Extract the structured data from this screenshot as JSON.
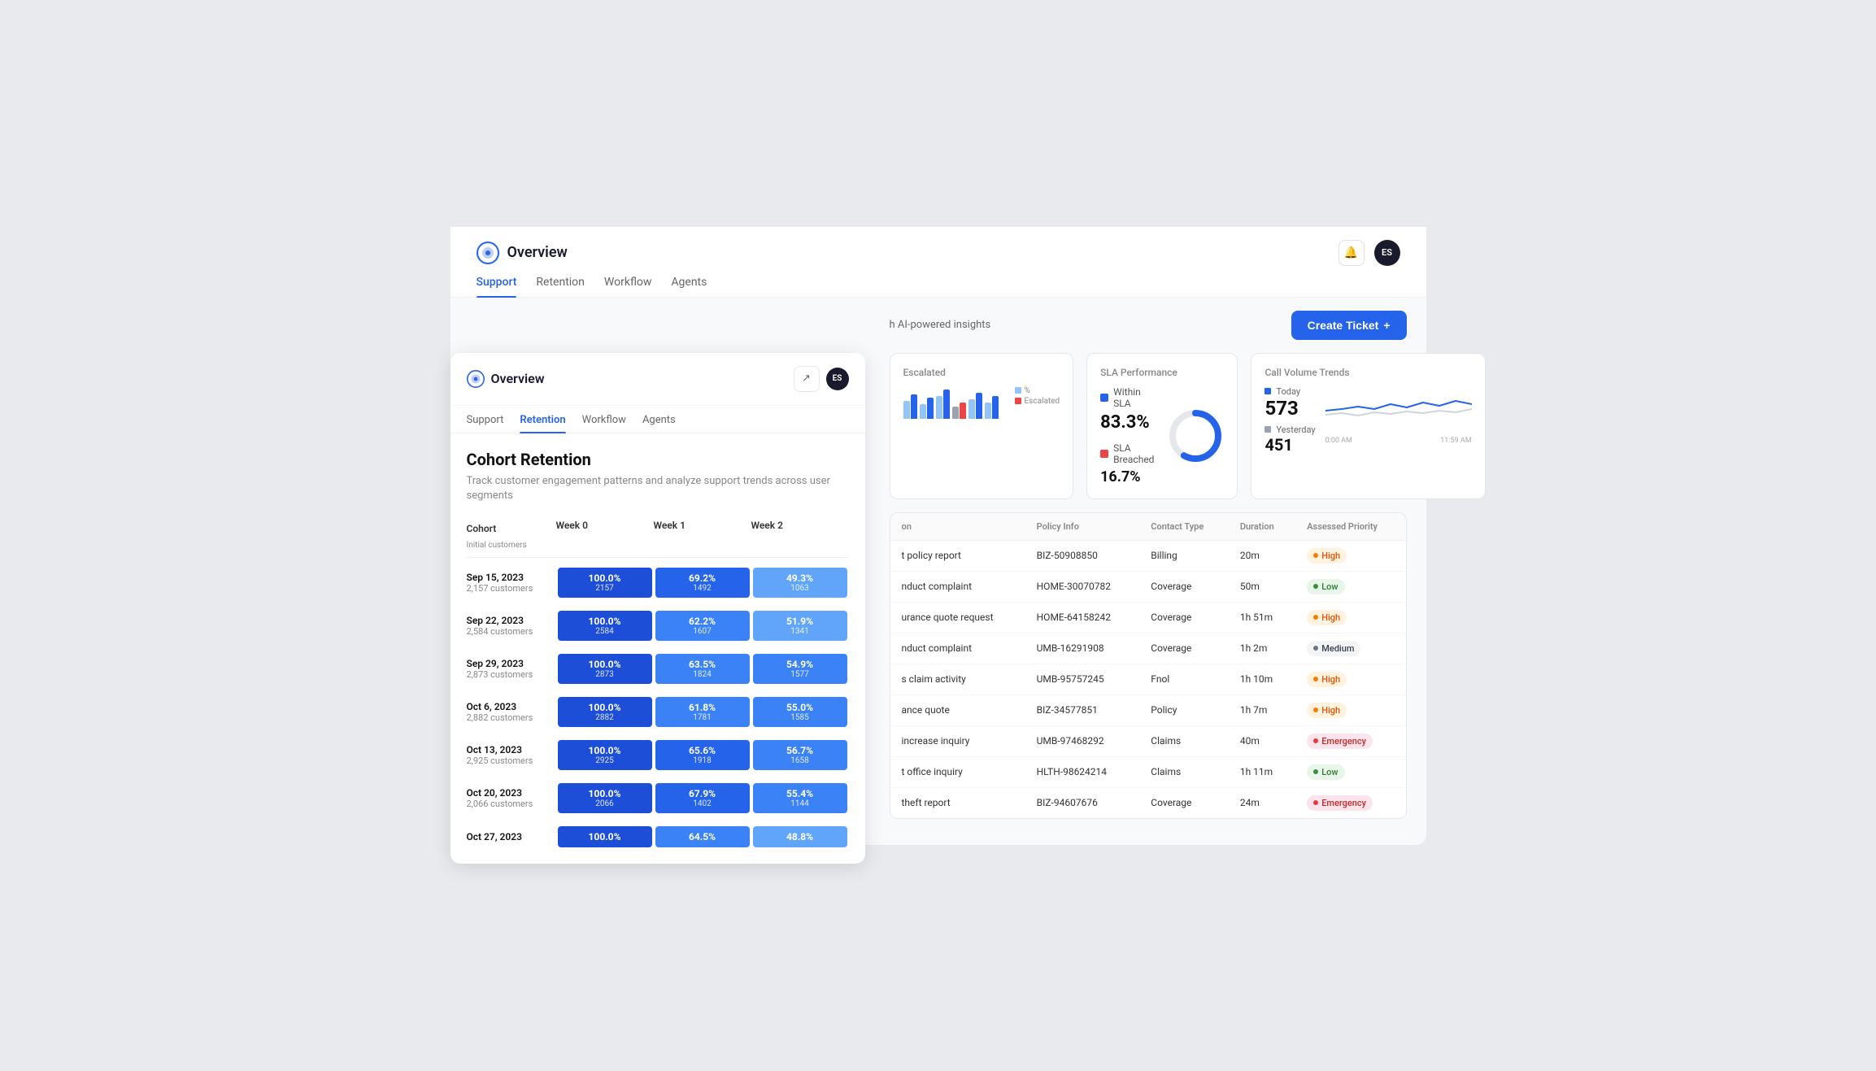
{
  "app": {
    "title": "Overview",
    "logo_alt": "app-logo"
  },
  "top_nav": {
    "items": [
      {
        "label": "Support",
        "active": false
      },
      {
        "label": "Retention",
        "active": false
      },
      {
        "label": "Workflow",
        "active": false
      },
      {
        "label": "Agents",
        "active": false
      }
    ]
  },
  "top_actions": {
    "notification_icon": "🔔",
    "avatar_initials": "ES"
  },
  "left_panel": {
    "title": "Overview",
    "avatar_initials": "ES",
    "nav_items": [
      {
        "label": "Support",
        "active": false
      },
      {
        "label": "Retention",
        "active": true
      },
      {
        "label": "Workflow",
        "active": false
      },
      {
        "label": "Agents",
        "active": false
      }
    ],
    "cohort": {
      "title": "Cohort Retention",
      "description": "Track customer engagement patterns and analyze support trends across user segments",
      "headers": {
        "cohort": "Cohort",
        "sub": "Initial customers",
        "week0": "Week 0",
        "week1": "Week 1",
        "week2": "Week 2"
      },
      "rows": [
        {
          "date": "Sep 15, 2023",
          "customers": "2,157 customers",
          "week0": {
            "pct": "100.0%",
            "val": "2157",
            "intensity": 1.0
          },
          "week1": {
            "pct": "69.2%",
            "val": "1492",
            "intensity": 0.69
          },
          "week2": {
            "pct": "49.3%",
            "val": "1063",
            "intensity": 0.49
          }
        },
        {
          "date": "Sep 22, 2023",
          "customers": "2,584 customers",
          "week0": {
            "pct": "100.0%",
            "val": "2584",
            "intensity": 1.0
          },
          "week1": {
            "pct": "62.2%",
            "val": "1607",
            "intensity": 0.62
          },
          "week2": {
            "pct": "51.9%",
            "val": "1341",
            "intensity": 0.52
          }
        },
        {
          "date": "Sep 29, 2023",
          "customers": "2,873 customers",
          "week0": {
            "pct": "100.0%",
            "val": "2873",
            "intensity": 1.0
          },
          "week1": {
            "pct": "63.5%",
            "val": "1824",
            "intensity": 0.635
          },
          "week2": {
            "pct": "54.9%",
            "val": "1577",
            "intensity": 0.55
          }
        },
        {
          "date": "Oct 6, 2023",
          "customers": "2,882 customers",
          "week0": {
            "pct": "100.0%",
            "val": "2882",
            "intensity": 1.0
          },
          "week1": {
            "pct": "61.8%",
            "val": "1781",
            "intensity": 0.618
          },
          "week2": {
            "pct": "55.0%",
            "val": "1585",
            "intensity": 0.55
          }
        },
        {
          "date": "Oct 13, 2023",
          "customers": "2,925 customers",
          "week0": {
            "pct": "100.0%",
            "val": "2925",
            "intensity": 1.0
          },
          "week1": {
            "pct": "65.6%",
            "val": "1918",
            "intensity": 0.656
          },
          "week2": {
            "pct": "56.7%",
            "val": "1658",
            "intensity": 0.567
          }
        },
        {
          "date": "Oct 20, 2023",
          "customers": "2,066 customers",
          "week0": {
            "pct": "100.0%",
            "val": "2066",
            "intensity": 1.0
          },
          "week1": {
            "pct": "67.9%",
            "val": "1402",
            "intensity": 0.679
          },
          "week2": {
            "pct": "55.4%",
            "val": "1144",
            "intensity": 0.554
          }
        },
        {
          "date": "Oct 27, 2023",
          "customers": "",
          "week0": {
            "pct": "100.0%",
            "val": "",
            "intensity": 1.0
          },
          "week1": {
            "pct": "64.5%",
            "val": "",
            "intensity": 0.645
          },
          "week2": {
            "pct": "48.8%",
            "val": "",
            "intensity": 0.488
          }
        }
      ]
    }
  },
  "dashboard": {
    "subtitle": "h AI-powered insights",
    "create_ticket_label": "Create Ticket",
    "metric_cards": {
      "card1": {
        "title": "SLA Performance",
        "within_sla_label": "Within SLA",
        "within_sla_value": "83.3%",
        "breached_label": "SLA Breached",
        "breached_value": "16.7%"
      },
      "card2": {
        "title": "Call Volume Trends",
        "today_label": "Today",
        "today_value": "573",
        "yesterday_label": "Yesterday",
        "yesterday_value": "451",
        "time_start": "0:00 AM",
        "time_end": "11:59 AM"
      }
    },
    "first_card": {
      "escalated_label": "Escalated",
      "escalated_pct": "%"
    },
    "table": {
      "columns": [
        "on",
        "Policy Info",
        "Contact Type",
        "Duration",
        "Assessed Priority"
      ],
      "rows": [
        {
          "desc": "t policy report",
          "policy": "BIZ-50908850",
          "contact": "Billing",
          "duration": "20m",
          "priority": "High",
          "priority_type": "high"
        },
        {
          "desc": "nduct complaint",
          "policy": "HOME-30070782",
          "contact": "Coverage",
          "duration": "50m",
          "priority": "Low",
          "priority_type": "low"
        },
        {
          "desc": "urance quote request",
          "policy": "HOME-64158242",
          "contact": "Coverage",
          "duration": "1h 51m",
          "priority": "High",
          "priority_type": "high"
        },
        {
          "desc": "nduct complaint",
          "policy": "UMB-16291908",
          "contact": "Coverage",
          "duration": "1h 2m",
          "priority": "Medium",
          "priority_type": "medium"
        },
        {
          "desc": "s claim activity",
          "policy": "UMB-95757245",
          "contact": "Fnol",
          "duration": "1h 10m",
          "priority": "High",
          "priority_type": "high"
        },
        {
          "desc": "ance quote",
          "policy": "BIZ-34577851",
          "contact": "Policy",
          "duration": "1h 7m",
          "priority": "High",
          "priority_type": "high"
        },
        {
          "desc": "increase inquiry",
          "policy": "UMB-97468292",
          "contact": "Claims",
          "duration": "40m",
          "priority": "Emergency",
          "priority_type": "emergency"
        },
        {
          "desc": "t office inquiry",
          "policy": "HLTH-98624214",
          "contact": "Claims",
          "duration": "1h 11m",
          "priority": "Low",
          "priority_type": "low"
        },
        {
          "desc": "theft report",
          "policy": "BIZ-94607676",
          "contact": "Coverage",
          "duration": "24m",
          "priority": "Emergency",
          "priority_type": "emergency"
        }
      ]
    }
  }
}
